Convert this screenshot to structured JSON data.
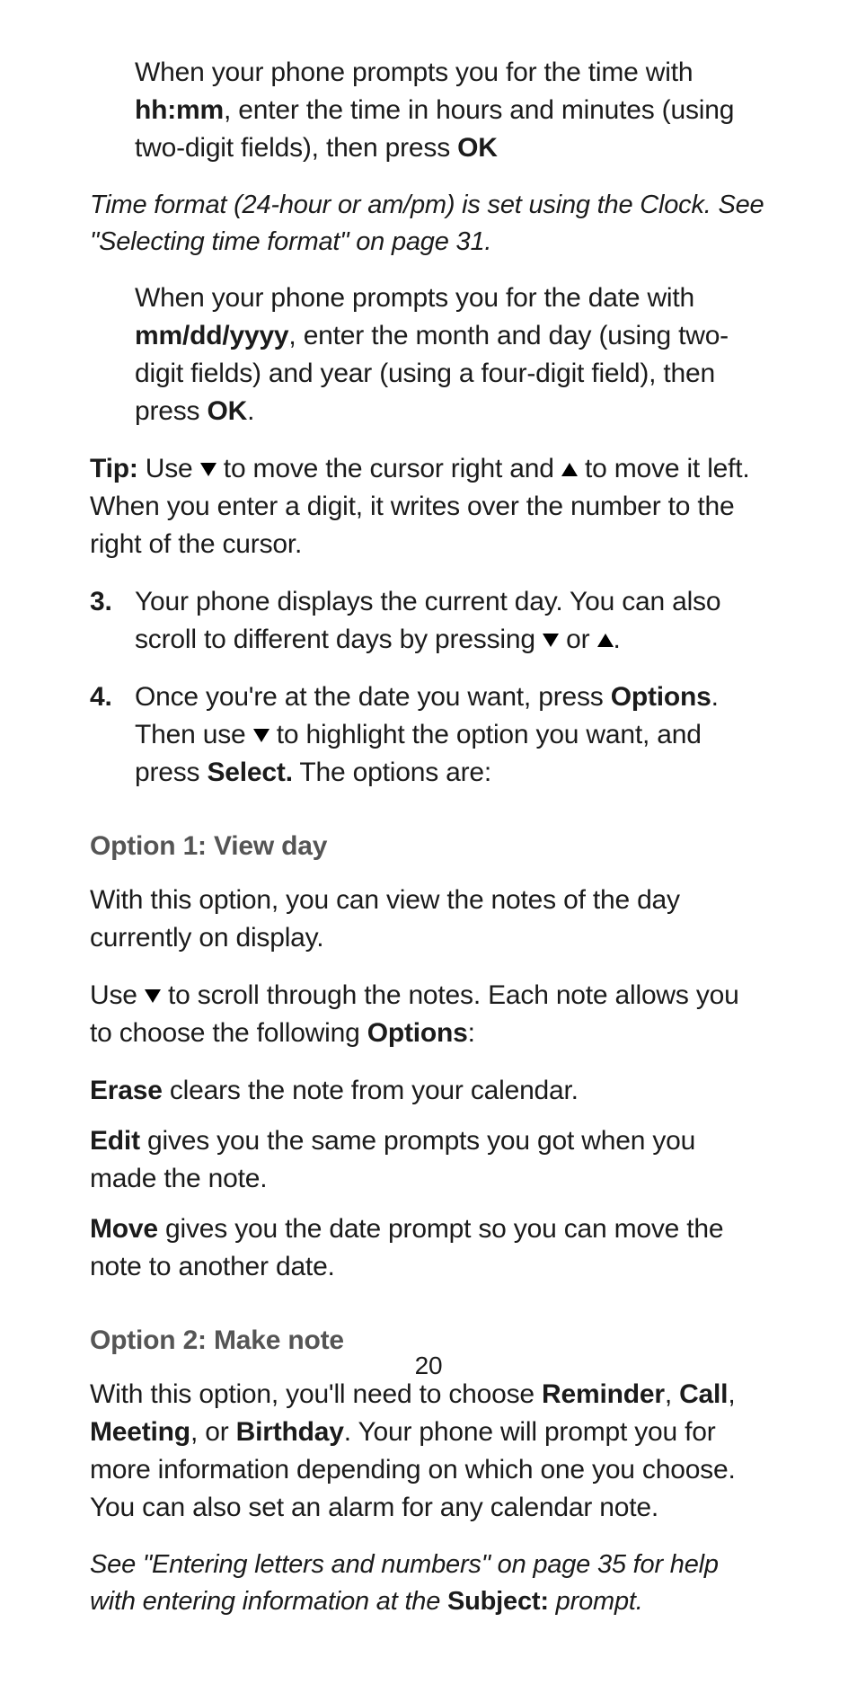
{
  "p1": {
    "a": "When your phone prompts you for the time with ",
    "b": "hh:mm",
    "c": ", enter the time in hours and minutes (using two-digit fields), then press ",
    "d": "OK"
  },
  "note1": "Time format (24-hour or am/pm) is set using the Clock. See \"Selecting time format\" on page 31.",
  "p2": {
    "a": "When your phone prompts you for the date with ",
    "b": "mm/dd/yyyy",
    "c": ", enter the month and day (using two-digit fields) and year (using a four-digit field), then press ",
    "d": "OK",
    "e": "."
  },
  "tip": {
    "label": "Tip:",
    "a": " Use ",
    "b": " to move the cursor right and ",
    "c": " to move it left. When you enter a digit, it writes over the number to the right of the cursor."
  },
  "step3": {
    "num": "3.",
    "a": "Your phone displays the current day. You can also scroll to different days by pressing ",
    "b": " or ",
    "c": "."
  },
  "step4": {
    "num": "4.",
    "a": "Once you're at the date you want, press ",
    "b": "Options",
    "c": ". Then use ",
    "d": " to highlight the option you want, and press ",
    "e": "Select.",
    "f": " The options are:"
  },
  "opt1h": "Option 1: View day",
  "opt1p1": "With this option, you can view the notes of the day currently on display.",
  "opt1p2": {
    "a": "Use ",
    "b": " to scroll through the notes. Each note allows you to choose the following ",
    "c": "Options",
    "d": ":"
  },
  "erase": {
    "b": "Erase",
    "t": " clears the note from your calendar."
  },
  "edit": {
    "b": "Edit",
    "t": " gives you the same prompts you got when you made the note."
  },
  "move": {
    "b": "Move",
    "t": " gives you the date prompt so you can move the note to another date."
  },
  "opt2h": "Option 2: Make note",
  "opt2p": {
    "a": "With this option, you'll need to choose ",
    "b": "Reminder",
    "c": ", ",
    "d": "Call",
    "e": ", ",
    "f": "Meeting",
    "g": ", or ",
    "h": "Birthday",
    "i": ". Your phone will prompt you for more information depending on which one you choose. You can also set an alarm for any calendar note."
  },
  "note2": {
    "a": "See \"Entering letters and numbers\" on page 35 for help with entering information at the ",
    "b": "Subject:",
    "c": " prompt."
  },
  "page_num": "20"
}
